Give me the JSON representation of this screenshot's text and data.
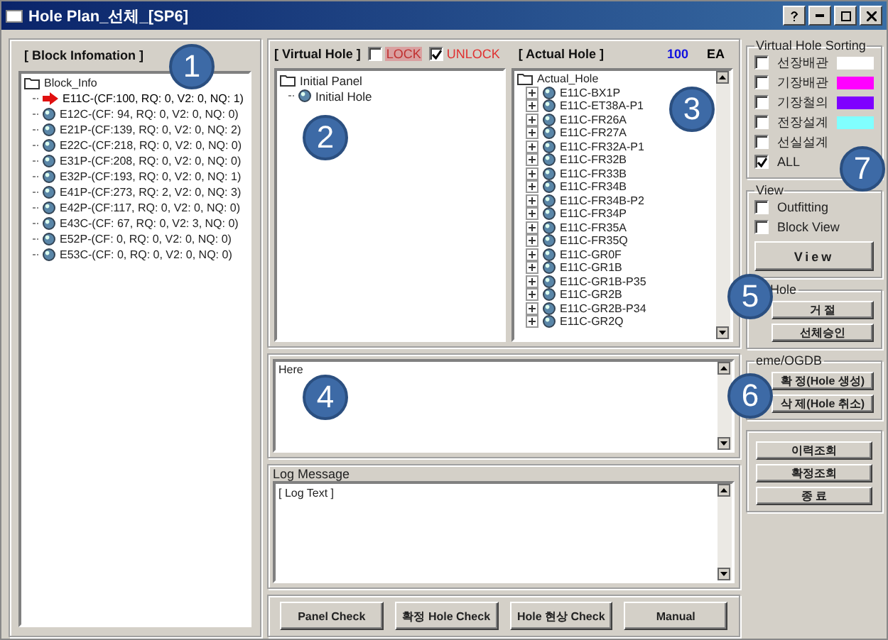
{
  "window": {
    "title": "Hole Plan_선체_[SP6]"
  },
  "block_info": {
    "title": "[ Block Infomation ]",
    "tree": {
      "label": "Block_Info",
      "children": [
        {
          "label": "E11C-(CF:100, RQ: 0, V2: 0, NQ: 1)",
          "selected": true
        },
        {
          "label": "E12C-(CF: 94, RQ: 0, V2: 0, NQ: 0)",
          "selected": false
        },
        {
          "label": "E21P-(CF:139, RQ: 0, V2: 0, NQ: 2)",
          "selected": false
        },
        {
          "label": "E22C-(CF:218, RQ: 0, V2: 0, NQ: 0)",
          "selected": false
        },
        {
          "label": "E31P-(CF:208, RQ: 0, V2: 0, NQ: 0)",
          "selected": false
        },
        {
          "label": "E32P-(CF:193, RQ: 0, V2: 0, NQ: 1)",
          "selected": false
        },
        {
          "label": "E41P-(CF:273, RQ: 2, V2: 0, NQ: 3)",
          "selected": false
        },
        {
          "label": "E42P-(CF:117, RQ: 0, V2: 0, NQ: 0)",
          "selected": false
        },
        {
          "label": "E43C-(CF: 67, RQ: 0, V2: 3, NQ: 0)",
          "selected": false
        },
        {
          "label": "E52P-(CF: 0, RQ: 0, V2: 0, NQ: 0)",
          "selected": false
        },
        {
          "label": "E53C-(CF: 0, RQ: 0, V2: 0, NQ: 0)",
          "selected": false
        }
      ]
    }
  },
  "virtual_hole": {
    "title": "[ Virtual Hole ]",
    "lock": {
      "label": "LOCK",
      "checked": false
    },
    "unlock": {
      "label": "UNLOCK",
      "checked": true
    },
    "tree": {
      "label": "Initial Panel",
      "children": [
        {
          "label": "Initial Hole"
        }
      ]
    }
  },
  "actual_hole": {
    "title": "[ Actual Hole ]",
    "count": "100",
    "unit": "EA",
    "tree": {
      "label": "Actual_Hole",
      "children": [
        {
          "label": "E11C-BX1P",
          "expanded": false
        },
        {
          "label": "E11C-ET38A-P1",
          "expanded": false
        },
        {
          "label": "E11C-FR26A",
          "expanded": false
        },
        {
          "label": "E11C-FR27A",
          "expanded": false
        },
        {
          "label": "E11C-FR32A-P1",
          "expanded": false
        },
        {
          "label": "E11C-FR32B",
          "expanded": false
        },
        {
          "label": "E11C-FR33B",
          "expanded": false
        },
        {
          "label": "E11C-FR34B",
          "expanded": false
        },
        {
          "label": "E11C-FR34B-P2",
          "expanded": false
        },
        {
          "label": "E11C-FR34P",
          "expanded": false
        },
        {
          "label": "E11C-FR35A",
          "expanded": false
        },
        {
          "label": "E11C-FR35Q",
          "expanded": false
        },
        {
          "label": "E11C-GR0F",
          "expanded": false
        },
        {
          "label": "E11C-GR1B",
          "expanded": false
        },
        {
          "label": "E11C-GR1B-P35",
          "expanded": false
        },
        {
          "label": "E11C-GR2B",
          "expanded": false
        },
        {
          "label": "E11C-GR2B-P34",
          "expanded": false
        },
        {
          "label": "E11C-GR2Q",
          "expanded": false
        }
      ]
    }
  },
  "memo": {
    "value": "Here"
  },
  "log": {
    "title": "Log Message",
    "value": "[ Log Text ]"
  },
  "bottom_buttons": [
    "Panel Check",
    "확정 Hole Check",
    "Hole 현상 Check",
    "Manual"
  ],
  "sorting": {
    "title": "Virtual Hole Sorting",
    "items": [
      {
        "label": "선장배관",
        "checked": false,
        "color": "#ffffff"
      },
      {
        "label": "기장배관",
        "checked": false,
        "color": "#ff00ff"
      },
      {
        "label": "기장철의",
        "checked": false,
        "color": "#7f00ff"
      },
      {
        "label": "전장설계",
        "checked": false,
        "color": "#80ffff"
      },
      {
        "label": "선실설계",
        "checked": false
      },
      {
        "label": "ALL",
        "checked": true
      }
    ]
  },
  "view": {
    "title": "View",
    "options": [
      {
        "label": "Outfitting",
        "checked": false
      },
      {
        "label": "Block View",
        "checked": false
      }
    ],
    "button": "View"
  },
  "hole": {
    "title": "Hole",
    "buttons": [
      "거 절",
      "선체승인"
    ]
  },
  "scheme": {
    "title": "eme/OGDB",
    "buttons": [
      "확 정(Hole 생성)",
      "삭 제(Hole 취소)"
    ]
  },
  "other_buttons": [
    "이력조회",
    "확정조회",
    "종 료"
  ],
  "annotations": [
    "1",
    "2",
    "3",
    "4",
    "5",
    "6",
    "7"
  ]
}
